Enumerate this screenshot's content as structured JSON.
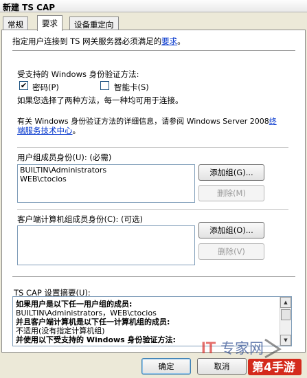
{
  "window": {
    "title": "新建 TS CAP"
  },
  "tabs": [
    {
      "label": "常规"
    },
    {
      "label": "要求"
    },
    {
      "label": "设备重定向"
    }
  ],
  "intro": {
    "text": "指定用户连接到 TS 网关服务器必须满足的",
    "link": "要求",
    "suffix": "。"
  },
  "auth": {
    "heading": "受支持的 Windows 身份验证方法:",
    "password_label": "密码(P)",
    "password_checked": true,
    "smartcard_label": "智能卡(S)",
    "smartcard_checked": false,
    "note": "如果您选择了两种方法，每一种均可用于连接。",
    "info_line1": "有关 Windows 身份验证方法的详细信息，请参阅 Windows Server 2008",
    "info_link1": "终",
    "info_link2": "端服务技术中心",
    "info_suffix": "。"
  },
  "user_groups": {
    "label": "用户组成员身份(U): (必需)",
    "items": [
      "BUILTIN\\Administrators",
      "WEB\\ctocios"
    ],
    "add_label": "添加组(G)...",
    "remove_label": "删除(M)"
  },
  "client_groups": {
    "label": "客户端计算机组成员身份(C): (可选)",
    "items": [],
    "add_label": "添加组(O)...",
    "remove_label": "删除(V)"
  },
  "summary": {
    "label": "TS CAP 设置摘要(U):",
    "lines": [
      {
        "text": "如果用户是以下任一用户组的成员:",
        "bold": true
      },
      {
        "text": "BUILTIN\\Administrators，WEB\\ctocios",
        "bold": false
      },
      {
        "text": "并且客户端计算机是以下任一计算机组的成员:",
        "bold": true
      },
      {
        "text": "不适用(没有指定计算机组)",
        "bold": false
      },
      {
        "text": "并使用以下受支持的 Windows 身份验证方法:",
        "bold": true
      }
    ]
  },
  "footer": {
    "ok_label": "确定",
    "cancel_label": "取消"
  },
  "watermark": {
    "brand": "IT专家网",
    "site": "第4手游"
  }
}
